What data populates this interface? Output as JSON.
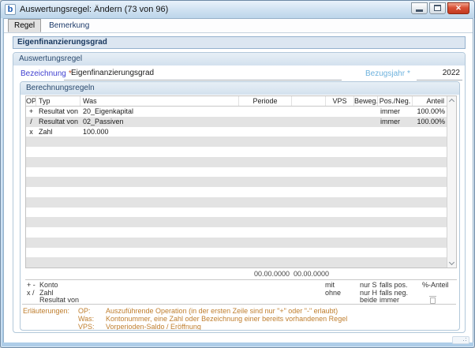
{
  "window": {
    "icon_letter": "b",
    "title": "Auswertungsregel: Ändern (73 von 96)"
  },
  "icons": {
    "close_glyph": "✕"
  },
  "tabs": [
    {
      "label": "Regel"
    },
    {
      "label": "Bemerkung"
    }
  ],
  "page_header": "Eigenfinanzierungsgrad",
  "form": {
    "group_title": "Auswertungsregel",
    "fields": {
      "bezeichnung": {
        "label": "Bezeichnung",
        "required": "*",
        "value": "Eigenfinanzierungsgrad"
      },
      "bezugsjahr": {
        "label": "Bezugsjahr",
        "required": "*",
        "value": "2022"
      }
    }
  },
  "rules": {
    "group_title": "Berechnungsregeln",
    "columns": [
      "OP",
      "Typ",
      "Was",
      "Periode",
      "",
      "VPS",
      "Beweg.",
      "Pos./Neg.",
      "Anteil"
    ],
    "rows": [
      {
        "op": "+",
        "typ": "Resultat von",
        "was": "20_Eigenkapital",
        "periode": "",
        "periode2": "",
        "vps": "",
        "beweg": "",
        "pos_neg": "immer",
        "anteil": "100.00%"
      },
      {
        "op": "/",
        "typ": "Resultat von",
        "was": "02_Passiven",
        "periode": "",
        "periode2": "",
        "vps": "",
        "beweg": "",
        "pos_neg": "immer",
        "anteil": "100.00%"
      },
      {
        "op": "x",
        "typ": "Zahl",
        "was": "100.000",
        "periode": "",
        "periode2": "",
        "vps": "",
        "beweg": "",
        "pos_neg": "",
        "anteil": ""
      }
    ],
    "total_rows": 16,
    "date_formats": [
      "00.00.0000",
      "00.00.0000"
    ]
  },
  "legend": {
    "op_symbols": [
      "+ -",
      "x /"
    ],
    "typ_options": [
      "Konto",
      "Zahl",
      "Resultat von"
    ],
    "vps_options": [
      "mit",
      "ohne"
    ],
    "beweg_options": [
      "nur S",
      "nur H",
      "beide"
    ],
    "posneg_options": [
      "falls pos.",
      "falls neg.",
      "immer"
    ],
    "anteil_label": "%-Anteil"
  },
  "notes": {
    "title": "Erläuterungen:",
    "items": [
      {
        "key": "OP:",
        "text": "Auszuführende Operation (in der ersten Zeile sind nur \"+\" oder \"-\" erlaubt)"
      },
      {
        "key": "Was:",
        "text": "Kontonummer, eine Zahl oder Bezeichnung einer bereits vorhandenen Regel"
      },
      {
        "key": "VPS:",
        "text": "Vorperioden-Saldo / Eröffnung"
      }
    ]
  },
  "colors": {
    "titlebar_blue": "#cfe1f1",
    "row_stripe": "#e3e3e3",
    "group_band": "#d9e4f0",
    "label_blue": "#3f3fd0",
    "bezugsjahr_blue": "#6db2dd",
    "notes_orange": "#bf7e2e",
    "close_red": "#d95136"
  }
}
